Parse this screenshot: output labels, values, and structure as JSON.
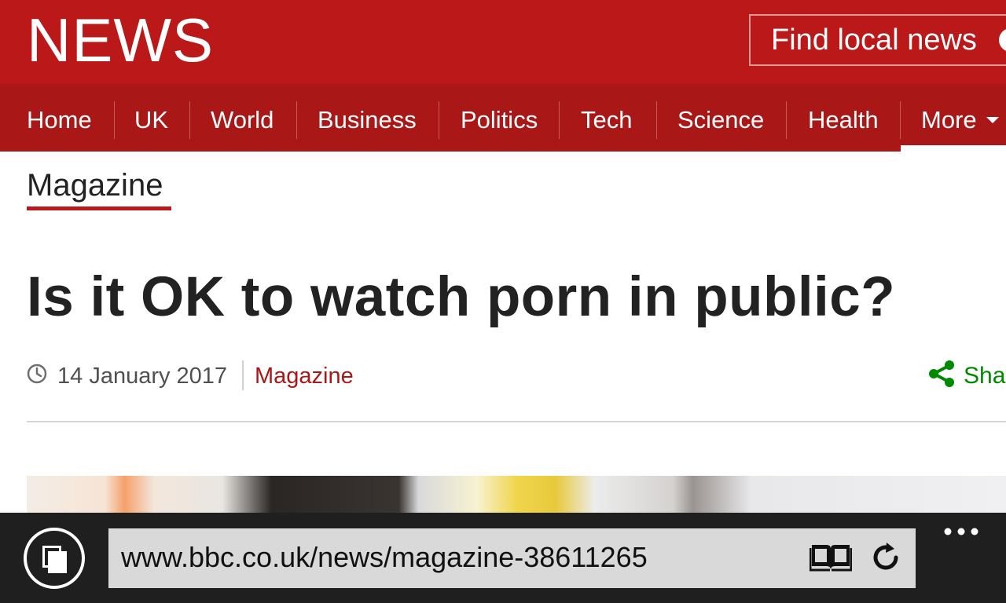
{
  "header": {
    "logo": "NEWS",
    "find_local": "Find local news"
  },
  "nav": {
    "items": [
      "Home",
      "UK",
      "World",
      "Business",
      "Politics",
      "Tech",
      "Science",
      "Health",
      "More"
    ]
  },
  "article": {
    "section": "Magazine",
    "headline": "Is it OK to watch porn in public?",
    "date": "14 January 2017",
    "section_link": "Magazine",
    "share_label": "Sha"
  },
  "browser": {
    "url": "www.bbc.co.uk/news/magazine-38611265"
  },
  "colors": {
    "brand_red": "#bb1919",
    "nav_red": "#a91717",
    "share_green": "#008a00"
  }
}
